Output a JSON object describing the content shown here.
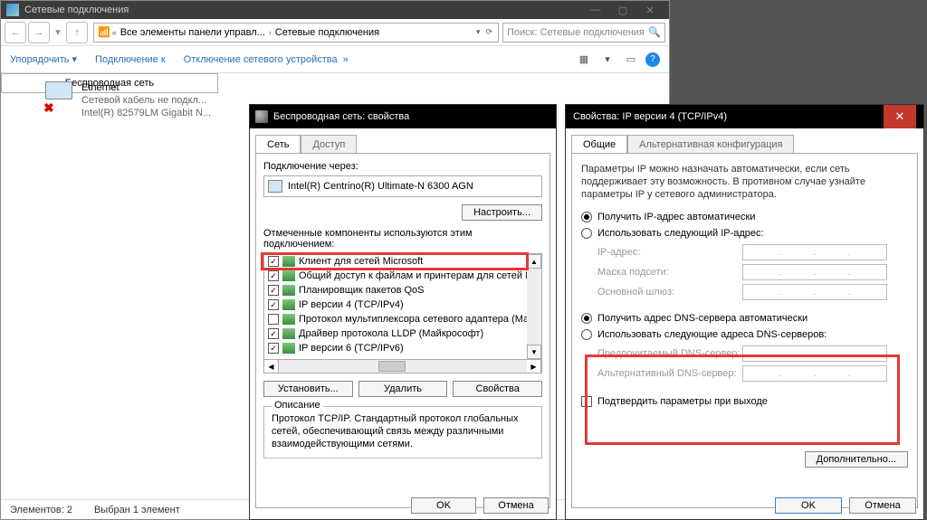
{
  "explorer": {
    "title": "Сетевые подключения",
    "breadcrumb1": "Все элементы панели управл...",
    "breadcrumb2": "Сетевые подключения",
    "search_placeholder": "Поиск: Сетевые подключения",
    "menu": {
      "organize": "Упорядочить",
      "connect": "Подключение к",
      "disable": "Отключение сетевого устройства"
    },
    "conn_ethernet": {
      "name": "Ethernet",
      "status": "Сетевой кабель не подкл...",
      "adapter": "Intel(R) 82579LM Gigabit N..."
    },
    "conn_wifi": {
      "name": "Беспроводная сеть"
    },
    "status_items": "Элементов: 2",
    "status_selected": "Выбран 1 элемент"
  },
  "props": {
    "title": "Беспроводная сеть: свойства",
    "tab_net": "Сеть",
    "tab_access": "Доступ",
    "connect_via": "Подключение через:",
    "adapter": "Intel(R) Centrino(R) Ultimate-N 6300 AGN",
    "btn_configure": "Настроить...",
    "list_label": "Отмеченные компоненты используются этим подключением:",
    "components": [
      "Клиент для сетей Microsoft",
      "Общий доступ к файлам и принтерам для сетей Mi",
      "Планировщик пакетов QoS",
      "IP версии 4 (TCP/IPv4)",
      "Протокол мультиплексора сетевого адаптера (Ма",
      "Драйвер протокола LLDP (Майкрософт)",
      "IP версии 6 (TCP/IPv6)"
    ],
    "btn_install": "Установить...",
    "btn_remove": "Удалить",
    "btn_props": "Свойства",
    "desc_label": "Описание",
    "desc_text": "Протокол TCP/IP. Стандартный протокол глобальных сетей, обеспечивающий связь между различными взаимодействующими сетями.",
    "btn_ok": "OK",
    "btn_cancel": "Отмена"
  },
  "ipv4": {
    "title": "Свойства: IP версии 4 (TCP/IPv4)",
    "tab_general": "Общие",
    "tab_alt": "Альтернативная конфигурация",
    "desc": "Параметры IP можно назначать автоматически, если сеть поддерживает эту возможность. В противном случае узнайте параметры IP у сетевого администратора.",
    "r_ip_auto": "Получить IP-адрес автоматически",
    "r_ip_manual": "Использовать следующий IP-адрес:",
    "f_ip": "IP-адрес:",
    "f_mask": "Маска подсети:",
    "f_gw": "Основной шлюз:",
    "r_dns_auto": "Получить адрес DNS-сервера автоматически",
    "r_dns_manual": "Использовать следующие адреса DNS-серверов:",
    "f_dns1": "Предпочитаемый DNS-сервер:",
    "f_dns2": "Альтернативный DNS-сервер:",
    "chk_confirm": "Подтвердить параметры при выходе",
    "btn_adv": "Дополнительно...",
    "btn_ok": "OK",
    "btn_cancel": "Отмена"
  }
}
